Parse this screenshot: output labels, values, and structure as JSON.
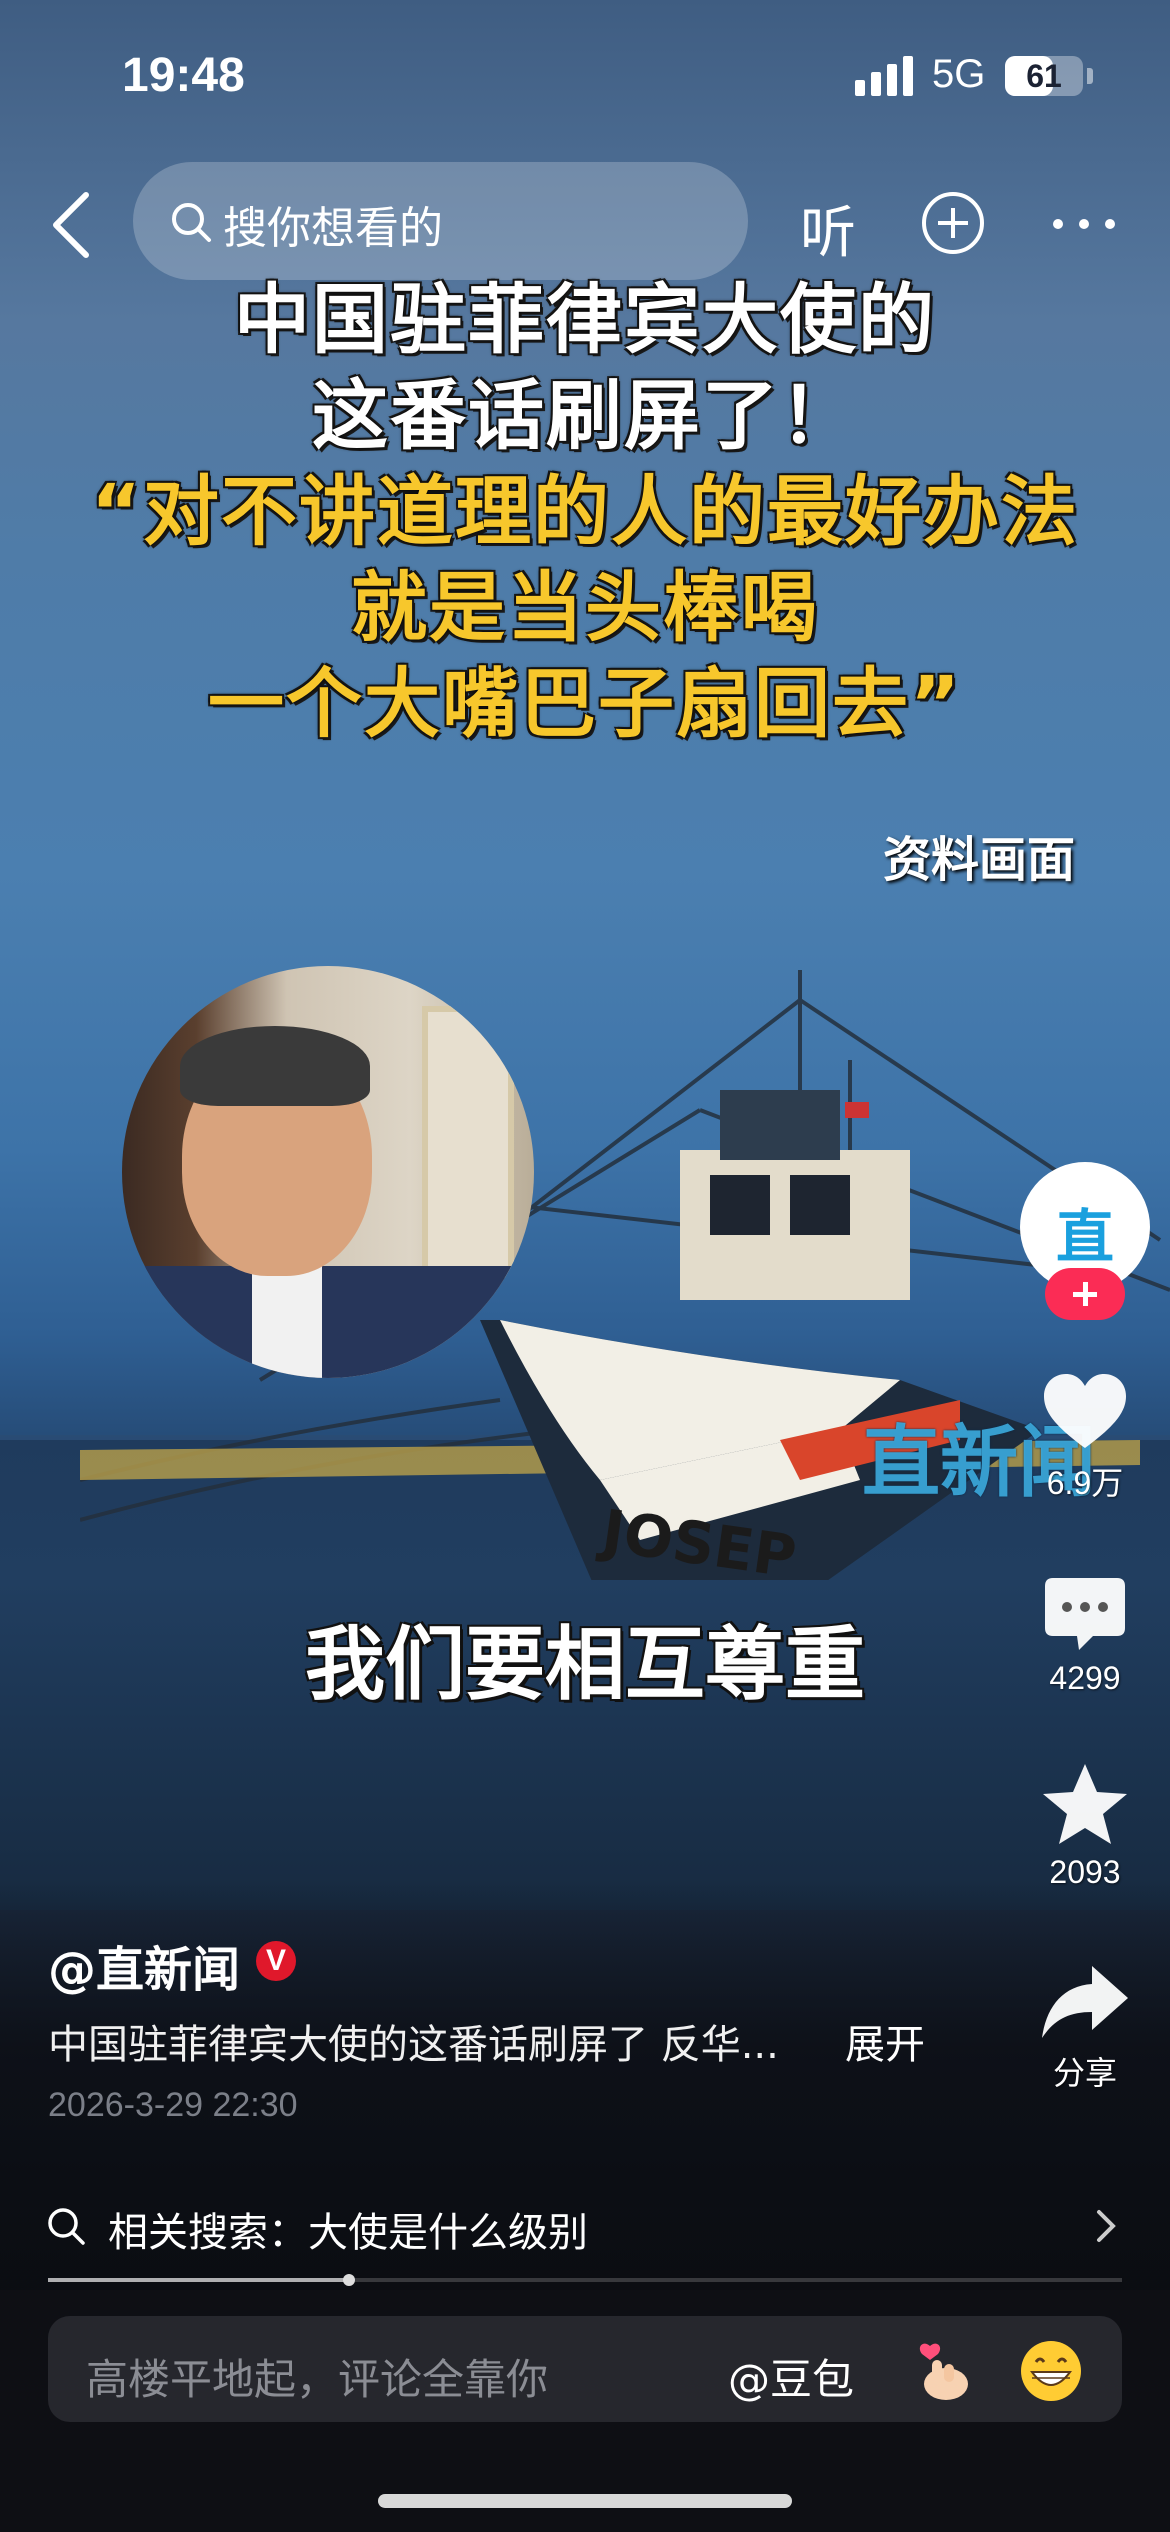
{
  "status_bar": {
    "time": "19:48",
    "network": "5G",
    "battery": "61",
    "battery_level": 0.61
  },
  "nav": {
    "search_placeholder": "搜你想看的",
    "listen_label": "听"
  },
  "video": {
    "headline_lines": [
      "中国驻菲律宾大使的",
      "这番话刷屏了！",
      "“对不讲道理的人的最好办法",
      "就是当头棒喝",
      "一个大嘴巴子扇回去”"
    ],
    "source_tag": "资料画面",
    "watermark": "直新闻",
    "boat_name": "JOSEP",
    "subtitle": "我们要相互尊重"
  },
  "rail": {
    "avatar_text": "直",
    "likes": "6.9万",
    "comments": "4299",
    "favorites": "2093",
    "share_label": "分享"
  },
  "caption": {
    "author": "@直新闻",
    "verified_mark": "V",
    "description": "中国驻菲律宾大使的这番话刷屏了 反华...",
    "expand_label": "展开",
    "date": "2026-3-29 22:30"
  },
  "related_search": {
    "text": "相关搜索：大使是什么级别"
  },
  "playback": {
    "progress": 0.28
  },
  "comment_bar": {
    "placeholder": "高楼平地起，评论全靠你",
    "mention": "@豆包"
  },
  "colors": {
    "accent_red": "#fb2c55",
    "headline_yellow": "#f7c72c",
    "brand_blue": "#1aa0de"
  },
  "icons": [
    "back-icon",
    "search-icon",
    "add-circle-icon",
    "more-icon",
    "heart-icon",
    "comment-icon",
    "star-icon",
    "share-icon",
    "chevron-right-icon",
    "finger-heart-emoji",
    "grin-emoji"
  ]
}
